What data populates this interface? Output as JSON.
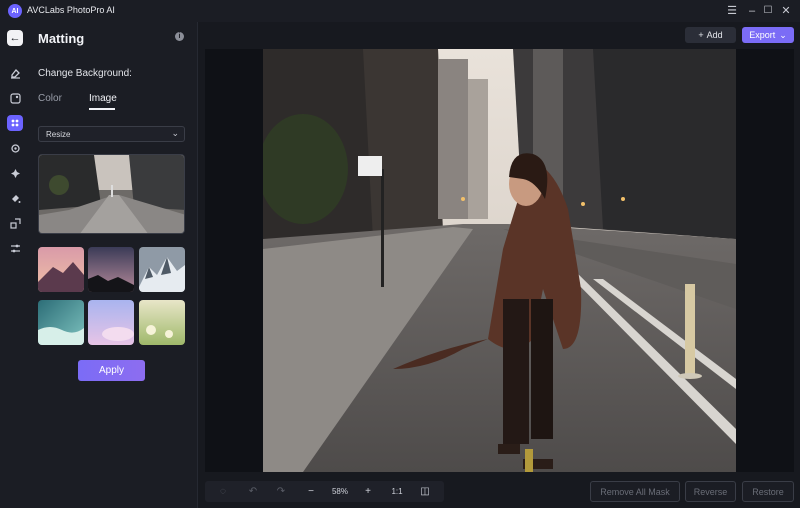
{
  "app": {
    "title": "AVCLabs PhotoPro AI",
    "logo_text": "AI"
  },
  "window_controls": {
    "menu": "☰",
    "minimize": "–",
    "maximize": "☐",
    "close": "✕"
  },
  "rail": {
    "back": "←",
    "icons": [
      "eraser-icon",
      "enhance-icon",
      "matting-icon",
      "color-icon",
      "replace-icon",
      "paint-icon",
      "upscale-icon",
      "adjust-icon"
    ]
  },
  "panel": {
    "title": "Matting",
    "info": "i",
    "section_label": "Change Background:",
    "tabs": {
      "color": "Color",
      "image": "Image",
      "active": "Image"
    },
    "select": {
      "value": "Resize",
      "chevron": "⌄"
    },
    "apply_label": "Apply"
  },
  "toolbar": {
    "add_label": "Add",
    "add_icon": "+",
    "export_label": "Export",
    "export_chevron": "⌄"
  },
  "bottom_toolbar": {
    "zoom_out": "−",
    "zoom_level": "58%",
    "zoom_in": "+",
    "actual_size": "1:1",
    "compare": "◫",
    "undo": "↶",
    "redo": "↷",
    "loading": "◌"
  },
  "actions": {
    "remove_all_mask": "Remove All Mask",
    "reverse": "Reverse",
    "restore": "Restore"
  }
}
